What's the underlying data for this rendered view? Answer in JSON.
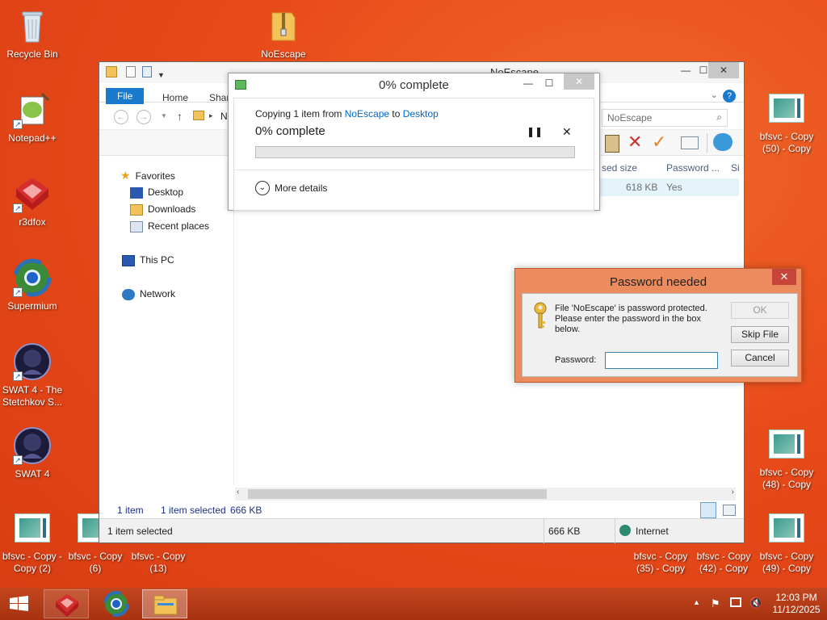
{
  "desktop": {
    "left_icons": [
      {
        "label": "Recycle Bin",
        "icon": "recycle-bin-icon"
      },
      {
        "label": "Notepad++",
        "icon": "notepad-plus-plus-icon"
      },
      {
        "label": "r3dfox",
        "icon": "r3dfox-icon"
      },
      {
        "label": "Supermium",
        "icon": "supermium-icon"
      },
      {
        "label": "SWAT 4 - The Stetchkov S...",
        "icon": "swat4-tss-icon"
      },
      {
        "label": "SWAT 4",
        "icon": "swat4-icon"
      }
    ],
    "top_folder": {
      "label": "NoEscape",
      "icon": "zip-folder-icon"
    },
    "bottom_left_files": [
      {
        "label": "bfsvc - Copy - Copy (2)"
      },
      {
        "label": "bfsvc - Copy (6)"
      },
      {
        "label": "bfsvc - Copy (13)"
      }
    ],
    "right_files": [
      {
        "label": "bfsvc - Copy (50) - Copy"
      },
      {
        "label": "bfsvc - Copy (48) - Copy"
      },
      {
        "label": "bfsvc - Copy (35) - Copy"
      },
      {
        "label": "bfsvc - Copy (42) - Copy"
      },
      {
        "label": "bfsvc - Copy (49) - Copy"
      }
    ]
  },
  "explorer": {
    "title": "NoEscape",
    "tabs": {
      "file": "File",
      "home": "Home",
      "share": "Shar"
    },
    "address_partial": "N",
    "search_placeholder": "NoEscape",
    "nav": {
      "favorites": "Favorites",
      "desktop": "Desktop",
      "downloads": "Downloads",
      "recent": "Recent places",
      "thispc": "This PC",
      "network": "Network"
    },
    "columns": {
      "size": "sed size",
      "password": "Password ...",
      "more": "Si"
    },
    "row": {
      "size": "618 KB",
      "password": "Yes"
    },
    "status_count": "1 item",
    "status_selected": "1 item selected",
    "status_size": "666 KB",
    "bottom_selected": "1 item selected",
    "bottom_size": "666 KB",
    "bottom_zone": "Internet"
  },
  "copy_dialog": {
    "title": "0% complete",
    "line_prefix": "Copying 1 item from ",
    "source": "NoEscape",
    "line_to": " to ",
    "destination": "Desktop",
    "progress_text": "0% complete",
    "progress_fraction": 0,
    "more_details": "More details"
  },
  "password_dialog": {
    "title": "Password needed",
    "message": "File 'NoEscape' is password protected. Please enter the password in the box below.",
    "password_label": "Password:",
    "password_value": "",
    "ok": "OK",
    "skip": "Skip File",
    "cancel": "Cancel"
  },
  "taskbar": {
    "time": "12:03 PM",
    "date": "11/12/2025"
  },
  "colors": {
    "desktop": "#e84b1a",
    "accent": "#1979ca",
    "password_frame": "#ec8c5e"
  }
}
